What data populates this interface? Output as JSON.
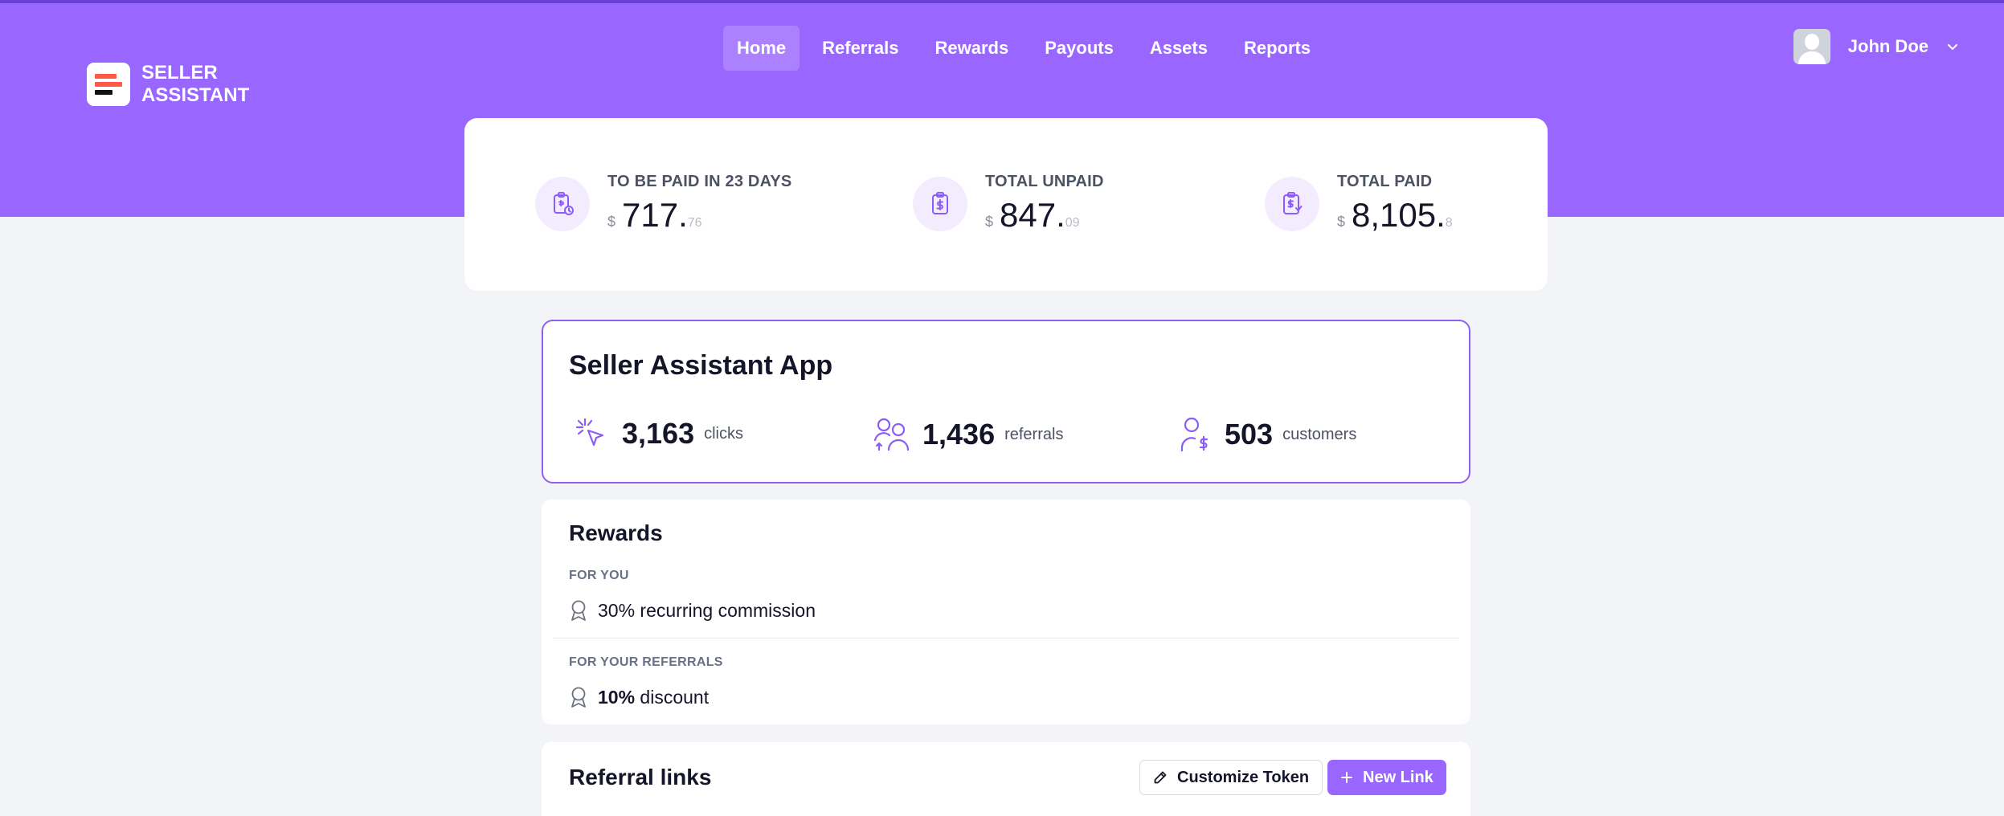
{
  "brand": {
    "line1": "SELLER",
    "line2": "ASSISTANT"
  },
  "nav": {
    "items": [
      {
        "label": "Home",
        "active": true
      },
      {
        "label": "Referrals"
      },
      {
        "label": "Rewards"
      },
      {
        "label": "Payouts"
      },
      {
        "label": "Assets"
      },
      {
        "label": "Reports"
      }
    ]
  },
  "user": {
    "name": "John Doe"
  },
  "stats": [
    {
      "label": "TO BE PAID IN 23 DAYS",
      "currency": "$",
      "whole": "717",
      "cents": "76",
      "icon": "clipboard-clock-icon"
    },
    {
      "label": "TOTAL UNPAID",
      "currency": "$",
      "whole": "847",
      "cents": "09",
      "icon": "clipboard-dollar-icon"
    },
    {
      "label": "TOTAL PAID",
      "currency": "$",
      "whole": "8,105",
      "cents": "8",
      "icon": "clipboard-check-icon"
    }
  ],
  "app": {
    "title": "Seller Assistant App",
    "metrics": [
      {
        "value": "3,163",
        "label": "clicks",
        "icon": "cursor-click-icon"
      },
      {
        "value": "1,436",
        "label": "referrals",
        "icon": "users-icon"
      },
      {
        "value": "503",
        "label": "customers",
        "icon": "user-dollar-icon"
      }
    ]
  },
  "rewards": {
    "title": "Rewards",
    "for_you_label": "FOR YOU",
    "for_you_text": "30% recurring commission",
    "for_referrals_label": "FOR YOUR REFERRALS",
    "for_referrals_bold": "10%",
    "for_referrals_text": " discount"
  },
  "referral_links": {
    "title": "Referral links",
    "customize_label": "Customize Token",
    "new_link_label": "New Link"
  },
  "colors": {
    "accent": "#9966ff",
    "accent_light": "#f3ecff",
    "background": "#f3f4f8"
  }
}
